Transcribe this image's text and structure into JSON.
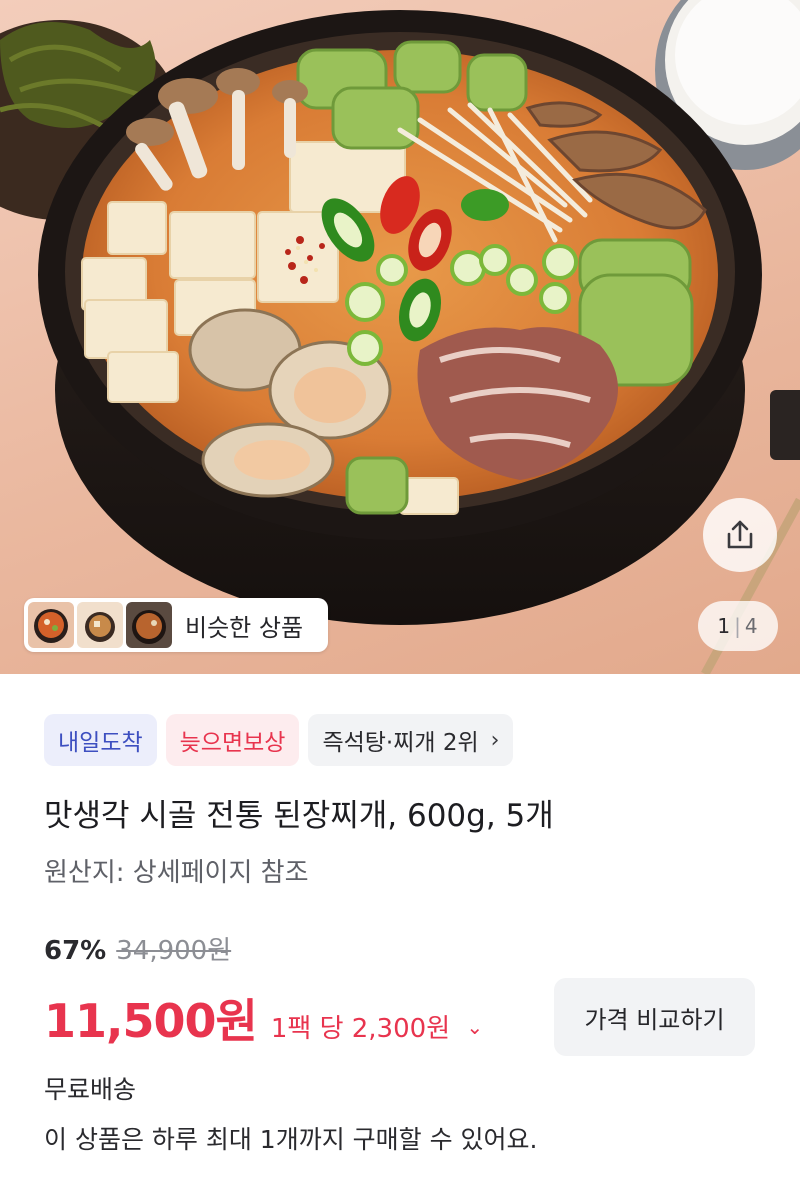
{
  "hero": {
    "counter_current": "1",
    "counter_separator": "|",
    "counter_total": "4",
    "similar_label": "비슷한 상품",
    "share_icon": "share-icon"
  },
  "badges": {
    "arrival": "내일도착",
    "late_comp": "늦으면보상",
    "rank": "즉석탕·찌개 2위",
    "rank_chevron": "›"
  },
  "product": {
    "title": "맛생각 시골 전통 된장찌개, 600g, 5개",
    "origin": "원산지: 상세페이지 참조"
  },
  "pricing": {
    "discount_rate": "67%",
    "original_price": "34,900원",
    "sale_price": "11,500원",
    "unit_price": "1팩 당 2,300원",
    "unit_chevron": "⌄",
    "compare_button": "가격 비교하기"
  },
  "delivery": {
    "shipping": "무료배송",
    "purchase_limit": "이 상품은 하루 최대 1개까지 구매할 수 있어요."
  },
  "colors": {
    "accent_red": "#e8344e",
    "badge_blue": "#3d4fc0",
    "badge_blue_bg": "#eceefb",
    "badge_red_bg": "#fdecee"
  }
}
